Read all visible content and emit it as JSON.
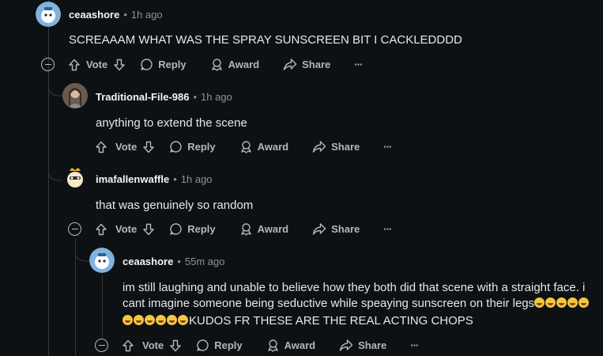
{
  "comments": [
    {
      "username": "ceaashore",
      "time": "1h ago",
      "body": "SCREAAAM WHAT WAS THE SPRAY SUNSCREEN BIT I CACKLEDDDD",
      "avatar": "snoo-avatar-blue"
    },
    {
      "username": "Traditional-File-986",
      "time": "1h ago",
      "body": "anything to extend the scene",
      "avatar": "photo-avatar"
    },
    {
      "username": "imafallenwaffle",
      "time": "1h ago",
      "body": "that was genuinely so random",
      "avatar": "snoo-avatar-yellow"
    },
    {
      "username": "ceaashore",
      "time": "55m ago",
      "body_line1": "im still laughing and unable to believe how they both did that scene with a straight face. i",
      "body_line2": "cant imagine someone being seductive while speaying sunscreen on their legs",
      "body_line3": "KUDOS FR THESE ARE THE REAL ACTING CHOPS",
      "emoji": "face-with-tears-of-joy",
      "avatar": "snoo-avatar-blue"
    }
  ],
  "actions": {
    "vote": "Vote",
    "reply": "Reply",
    "award": "Award",
    "share": "Share",
    "more": "···"
  },
  "colors": {
    "background": "#0e1113",
    "text": "#d7dadc",
    "meta": "#8b9297",
    "thread_line": "#33393d"
  }
}
